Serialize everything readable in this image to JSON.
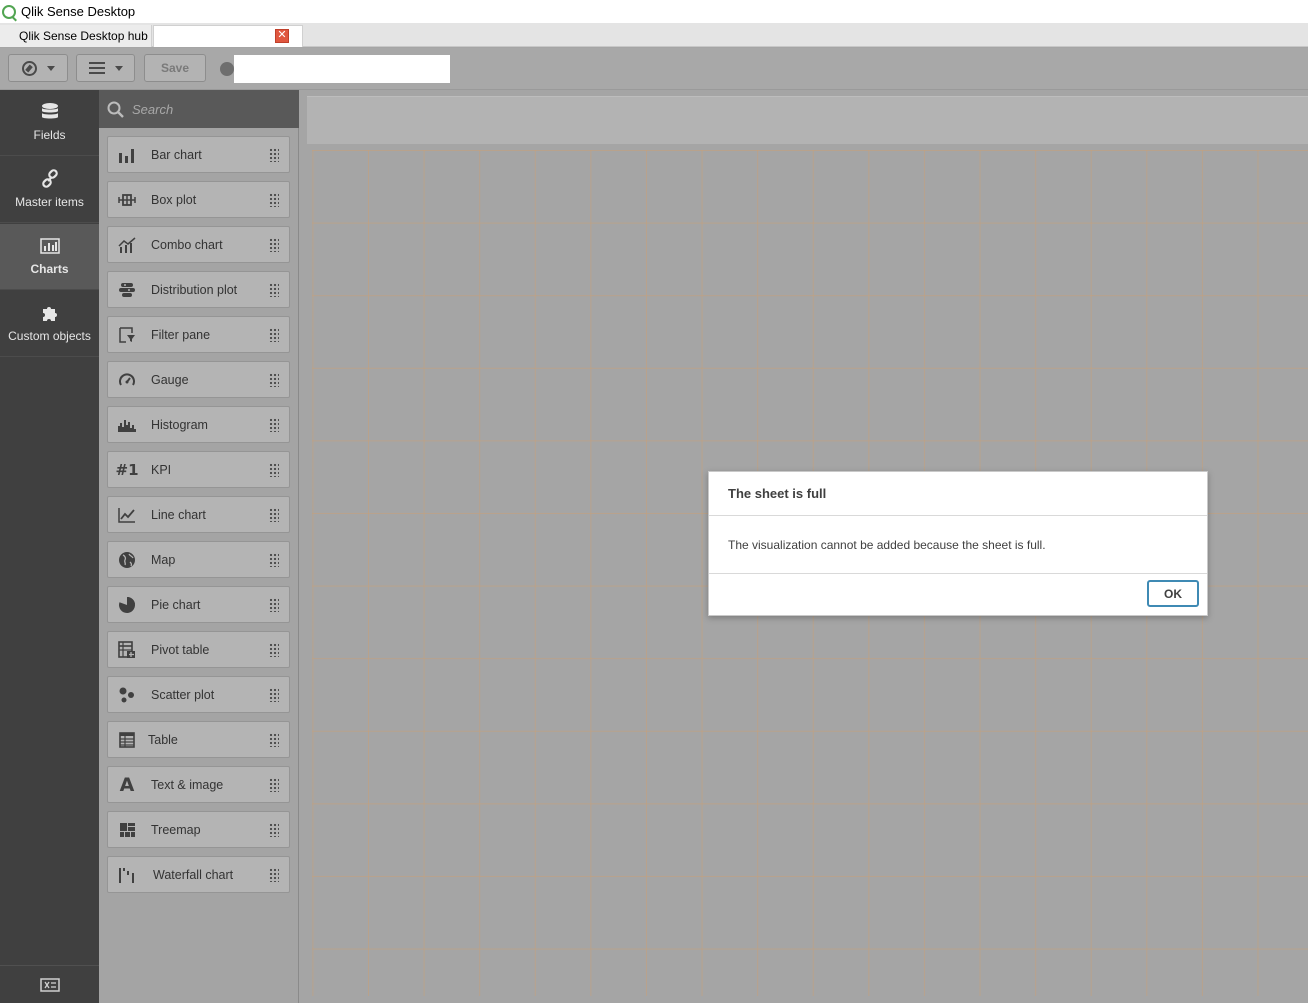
{
  "window": {
    "title": "Qlik Sense Desktop"
  },
  "tabs": [
    {
      "label": "Qlik Sense Desktop hub"
    },
    {
      "label": ""
    }
  ],
  "toolbar": {
    "save_label": "Save",
    "sheet_name": ""
  },
  "leftnav": {
    "items": [
      {
        "label": "Fields",
        "icon": "database-icon"
      },
      {
        "label": "Master items",
        "icon": "link-icon"
      },
      {
        "label": "Charts",
        "icon": "bar-chart-icon",
        "active": true
      },
      {
        "label": "Custom objects",
        "icon": "puzzle-icon"
      }
    ]
  },
  "assets": {
    "search_placeholder": "Search",
    "items": [
      {
        "label": "Bar chart",
        "icon": "bar-chart-icon"
      },
      {
        "label": "Box plot",
        "icon": "box-plot-icon"
      },
      {
        "label": "Combo chart",
        "icon": "combo-chart-icon"
      },
      {
        "label": "Distribution plot",
        "icon": "distribution-plot-icon"
      },
      {
        "label": "Filter pane",
        "icon": "filter-pane-icon"
      },
      {
        "label": "Gauge",
        "icon": "gauge-icon"
      },
      {
        "label": "Histogram",
        "icon": "histogram-icon"
      },
      {
        "label": "KPI",
        "icon": "kpi-icon"
      },
      {
        "label": "Line chart",
        "icon": "line-chart-icon"
      },
      {
        "label": "Map",
        "icon": "globe-icon"
      },
      {
        "label": "Pie chart",
        "icon": "pie-chart-icon"
      },
      {
        "label": "Pivot table",
        "icon": "pivot-table-icon"
      },
      {
        "label": "Scatter plot",
        "icon": "scatter-plot-icon"
      },
      {
        "label": "Table",
        "icon": "table-icon"
      },
      {
        "label": "Text & image",
        "icon": "text-image-icon"
      },
      {
        "label": "Treemap",
        "icon": "treemap-icon"
      },
      {
        "label": "Waterfall chart",
        "icon": "waterfall-chart-icon"
      }
    ]
  },
  "dialog": {
    "title": "The sheet is full",
    "message": "The visualization cannot be added because the sheet is full.",
    "ok_label": "OK"
  },
  "colors": {
    "accent": "#3f8ab4",
    "nav_bg": "#404040",
    "panel_bg": "#a4a4a4",
    "close_red": "#e0573f"
  }
}
